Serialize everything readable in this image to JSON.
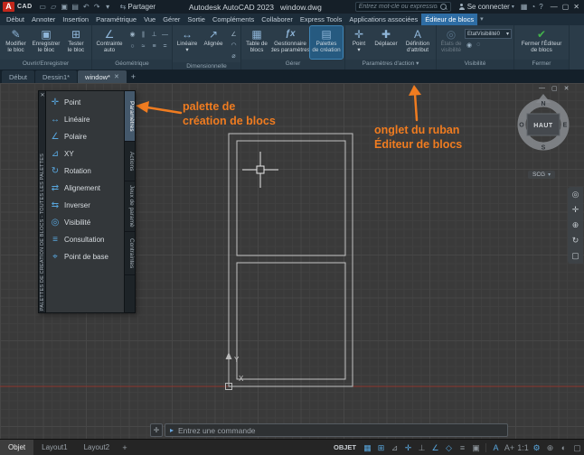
{
  "colors": {
    "accent_orange": "#f07c20",
    "ribbon_highlight": "#265a80",
    "check_green": "#43b14b",
    "icon_blue": "#58a6dd",
    "menu_active_blue": "#2e6da4"
  },
  "titlebar": {
    "logo_letter": "A",
    "logo_text": "CAD",
    "quick_access": [
      {
        "name": "new-file-icon",
        "glyph": "▭"
      },
      {
        "name": "open-file-icon",
        "glyph": "▱"
      },
      {
        "name": "save-icon",
        "glyph": "▣"
      },
      {
        "name": "print-icon",
        "glyph": "▤"
      },
      {
        "name": "undo-icon",
        "glyph": "↶"
      },
      {
        "name": "redo-icon",
        "glyph": "↷"
      },
      {
        "name": "qat-dropdown-icon",
        "glyph": "▾"
      }
    ],
    "share_icon": "⇆",
    "share_label": "Partager",
    "app_title": "Autodesk AutoCAD 2023   window.dwg",
    "search_placeholder": "Entrez mot-clé ou expression",
    "signin_label": "Se connecter",
    "signin_caret": "▾",
    "right_icons": [
      {
        "name": "cart-icon",
        "glyph": "▦"
      },
      {
        "name": "alerts-icon",
        "glyph": "◔"
      },
      {
        "name": "help-icon",
        "glyph": "?"
      }
    ],
    "window_controls": [
      {
        "name": "minimize-icon",
        "glyph": "—"
      },
      {
        "name": "restore-icon",
        "glyph": "▢"
      },
      {
        "name": "close-icon",
        "glyph": "✕"
      }
    ]
  },
  "menubar": {
    "items": [
      "Début",
      "Annoter",
      "Insertion",
      "Paramétrique",
      "Vue",
      "Gérer",
      "Sortie",
      "Compléments",
      "Collaborer",
      "Express Tools",
      "Applications associées"
    ],
    "active_tab": "Éditeur de blocs",
    "dropdown_icon": "▾"
  },
  "ribbon": {
    "groups": [
      {
        "label": "Ouvrir/Enregistrer",
        "buttons": [
          {
            "line1": "Modifier",
            "line2": "le bloc",
            "glyph": "✎"
          },
          {
            "line1": "Enregistrer",
            "line2": "le bloc",
            "glyph": "▣"
          },
          {
            "line1": "Tester",
            "line2": "le bloc",
            "glyph": "⊞"
          }
        ]
      },
      {
        "label": "Géométrique",
        "big": {
          "line1": "Contrainte",
          "line2": "auto",
          "glyph": "∠"
        },
        "minis": [
          {
            "name": "coincident-constraint-icon",
            "glyph": "◉"
          },
          {
            "name": "parallel-constraint-icon",
            "glyph": "∥"
          },
          {
            "name": "perpendicular-constraint-icon",
            "glyph": "⊥"
          },
          {
            "name": "horizontal-constraint-icon",
            "glyph": "—"
          },
          {
            "name": "tangent-constraint-icon",
            "glyph": "○"
          },
          {
            "name": "smooth-constraint-icon",
            "glyph": "≈"
          },
          {
            "name": "symmetric-constraint-icon",
            "glyph": "≡"
          },
          {
            "name": "equal-constraint-icon",
            "glyph": "="
          }
        ]
      },
      {
        "label": "Dimensionnelle",
        "buttons": [
          {
            "line1": "Linéaire",
            "line2": "▾",
            "glyph": "↔"
          },
          {
            "line1": "Alignée",
            "line2": "",
            "glyph": "↗"
          }
        ],
        "minis": [
          {
            "name": "angular-dim-icon",
            "glyph": "∠"
          },
          {
            "name": "radial-dim-icon",
            "glyph": "◠"
          },
          {
            "name": "diameter-dim-icon",
            "glyph": "⌀"
          }
        ]
      },
      {
        "label": "Gérer",
        "buttons": [
          {
            "line1": "Table de",
            "line2": "blocs",
            "glyph": "▦"
          },
          {
            "line1": "Gestionnaire",
            "line2": "des paramètres",
            "glyph": "ƒx"
          },
          {
            "line1": "Palettes",
            "line2": "de création",
            "glyph": "▤"
          }
        ]
      },
      {
        "label": "Paramètres d'action ▾",
        "buttons": [
          {
            "line1": "Point",
            "line2": "▾",
            "glyph": "✛"
          },
          {
            "line1": "Déplacer",
            "line2": "",
            "glyph": "✚"
          },
          {
            "line1": "Définition",
            "line2": "d'attribut",
            "glyph": "A"
          }
        ]
      },
      {
        "label": "Visibilité",
        "dim_button": {
          "line1": "États de",
          "line2": "visibilité",
          "glyph": "◎"
        },
        "state_dropdown": {
          "value": "EtatVisibilité0",
          "caret": "▾"
        },
        "minis": [
          {
            "name": "make-visible-icon",
            "glyph": "◉"
          },
          {
            "name": "make-invisible-icon",
            "glyph": "◌"
          }
        ]
      },
      {
        "label": "Fermer",
        "buttons": [
          {
            "line1": "Fermer l'Éditeur",
            "line2": "de blocs",
            "glyph": "✔"
          }
        ]
      }
    ]
  },
  "filetabs": {
    "tabs": [
      {
        "label": "Début"
      },
      {
        "label": "Dessin1*"
      },
      {
        "label": "window*",
        "close_icon": "✕"
      }
    ],
    "add_icon": "+"
  },
  "palette": {
    "title_vertical": "PALETTES DE CRÉATION DE BLOCS - TOUTES LES PALETTES",
    "close_icon": "✕",
    "items": [
      {
        "glyph": "✛",
        "label": "Point"
      },
      {
        "glyph": "↔",
        "label": "Linéaire"
      },
      {
        "glyph": "∠",
        "label": "Polaire"
      },
      {
        "glyph": "⊿",
        "label": "XY"
      },
      {
        "glyph": "↻",
        "label": "Rotation"
      },
      {
        "glyph": "⇄",
        "label": "Alignement"
      },
      {
        "glyph": "⇆",
        "label": "Inverser"
      },
      {
        "glyph": "◎",
        "label": "Visibilité"
      },
      {
        "glyph": "≡",
        "label": "Consultation"
      },
      {
        "glyph": "⌖",
        "label": "Point de base"
      }
    ],
    "tabs": [
      {
        "label": "Paramètres"
      },
      {
        "label": "Actions"
      },
      {
        "label": "Jeux de paramè"
      },
      {
        "label": "Contraintes"
      }
    ]
  },
  "canvas": {
    "viewport_controls": [
      {
        "name": "vp-minimize-icon",
        "glyph": "—"
      },
      {
        "name": "vp-restore-icon",
        "glyph": "▢"
      },
      {
        "name": "vp-close-icon",
        "glyph": "✕"
      }
    ],
    "viewcube": {
      "north": "N",
      "west": "O",
      "east": "E",
      "south": "S",
      "top_face": "HAUT",
      "ucs_label": "SCG",
      "ucs_caret": "▾"
    },
    "navbar_icons": [
      {
        "name": "navigation-wheel-icon",
        "glyph": "◎"
      },
      {
        "name": "pan-icon",
        "glyph": "✛"
      },
      {
        "name": "zoom-icon",
        "glyph": "⊕"
      },
      {
        "name": "orbit-icon",
        "glyph": "↻"
      },
      {
        "name": "showmotion-icon",
        "glyph": "▢"
      }
    ],
    "ucs": {
      "x_label": "X",
      "y_label": "Y"
    }
  },
  "annotations": {
    "palette_note_line1": "palette de",
    "palette_note_line2": "création de blocs",
    "ribbon_note_line1": "onglet du ruban",
    "ribbon_note_line2": "Éditeur de blocs"
  },
  "commandline": {
    "handle_icon": "✛",
    "prompt_icon": "▸",
    "placeholder": "Entrez une commande"
  },
  "statusbar": {
    "layout_tabs": [
      {
        "label": "Objet"
      },
      {
        "label": "Layout1"
      },
      {
        "label": "Layout2"
      }
    ],
    "add_layout_icon": "+",
    "model_label": "OBJET",
    "icons_left": [
      {
        "name": "grid-icon",
        "glyph": "▦",
        "active": true
      },
      {
        "name": "snap-icon",
        "glyph": "⊞",
        "active": true
      },
      {
        "name": "infer-constraints-icon",
        "glyph": "⊿",
        "active": false
      },
      {
        "name": "dynamic-input-icon",
        "glyph": "✛",
        "active": true
      },
      {
        "name": "ortho-icon",
        "glyph": "⊥",
        "active": false
      },
      {
        "name": "polar-tracking-icon",
        "glyph": "∠",
        "active": true
      },
      {
        "name": "object-snap-icon",
        "glyph": "◇",
        "active": true
      },
      {
        "name": "lineweight-icon",
        "glyph": "≡",
        "active": false
      },
      {
        "name": "selection-cycling-icon",
        "glyph": "▣",
        "active": false
      }
    ],
    "icons_right": [
      {
        "name": "annotation-visibility-icon",
        "glyph": "A",
        "active": true
      },
      {
        "name": "autoscale-icon",
        "glyph": "A+",
        "active": false
      },
      {
        "name": "annotation-scale-icon",
        "glyph": "1:1",
        "active": false
      },
      {
        "name": "workspace-gear-icon",
        "glyph": "⚙",
        "active": true
      },
      {
        "name": "annotation-monitor-icon",
        "glyph": "⊕",
        "active": false
      },
      {
        "name": "isolate-objects-icon",
        "glyph": "◐",
        "active": false
      },
      {
        "name": "clean-screen-icon",
        "glyph": "▢",
        "active": false
      }
    ]
  }
}
